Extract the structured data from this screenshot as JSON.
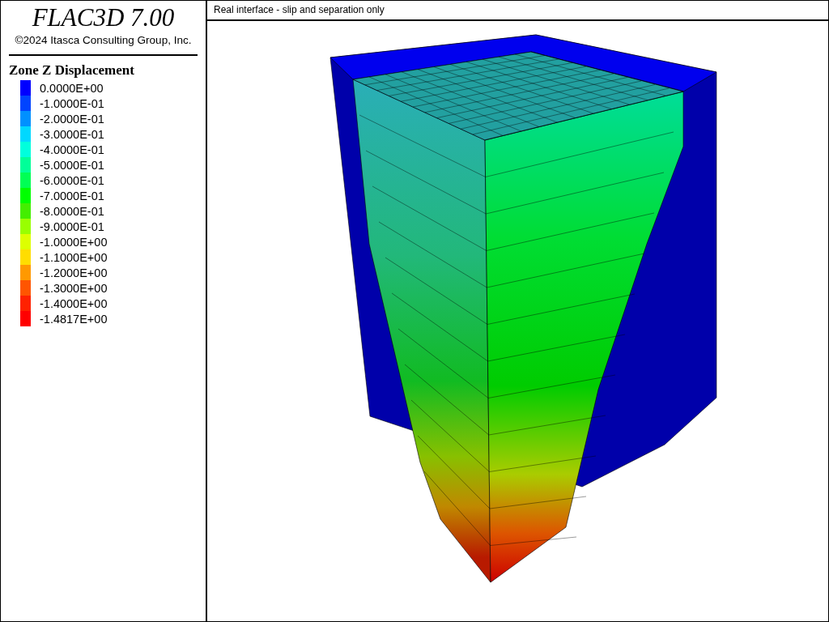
{
  "program_title": "FLAC3D 7.00",
  "copyright": "©2024 Itasca Consulting Group, Inc.",
  "legend": {
    "title": "Zone Z Displacement",
    "items": [
      {
        "label": "0.0000E+00",
        "color": "#0000ff"
      },
      {
        "label": "-1.0000E-01",
        "color": "#0044ff"
      },
      {
        "label": "-2.0000E-01",
        "color": "#0090ff"
      },
      {
        "label": "-3.0000E-01",
        "color": "#00d8ff"
      },
      {
        "label": "-4.0000E-01",
        "color": "#00ffdd"
      },
      {
        "label": "-5.0000E-01",
        "color": "#00ff99"
      },
      {
        "label": "-6.0000E-01",
        "color": "#00ff55"
      },
      {
        "label": "-7.0000E-01",
        "color": "#00ff00"
      },
      {
        "label": "-8.0000E-01",
        "color": "#44ee00"
      },
      {
        "label": "-9.0000E-01",
        "color": "#99ff00"
      },
      {
        "label": "-1.0000E+00",
        "color": "#ddff00"
      },
      {
        "label": "-1.1000E+00",
        "color": "#ffdd00"
      },
      {
        "label": "-1.2000E+00",
        "color": "#ff9900"
      },
      {
        "label": "-1.3000E+00",
        "color": "#ff5500"
      },
      {
        "label": "-1.4000E+00",
        "color": "#ff2200"
      },
      {
        "label": "-1.4817E+00",
        "color": "#ff0000"
      }
    ]
  },
  "plot": {
    "title": "Real interface - slip and separation only"
  }
}
